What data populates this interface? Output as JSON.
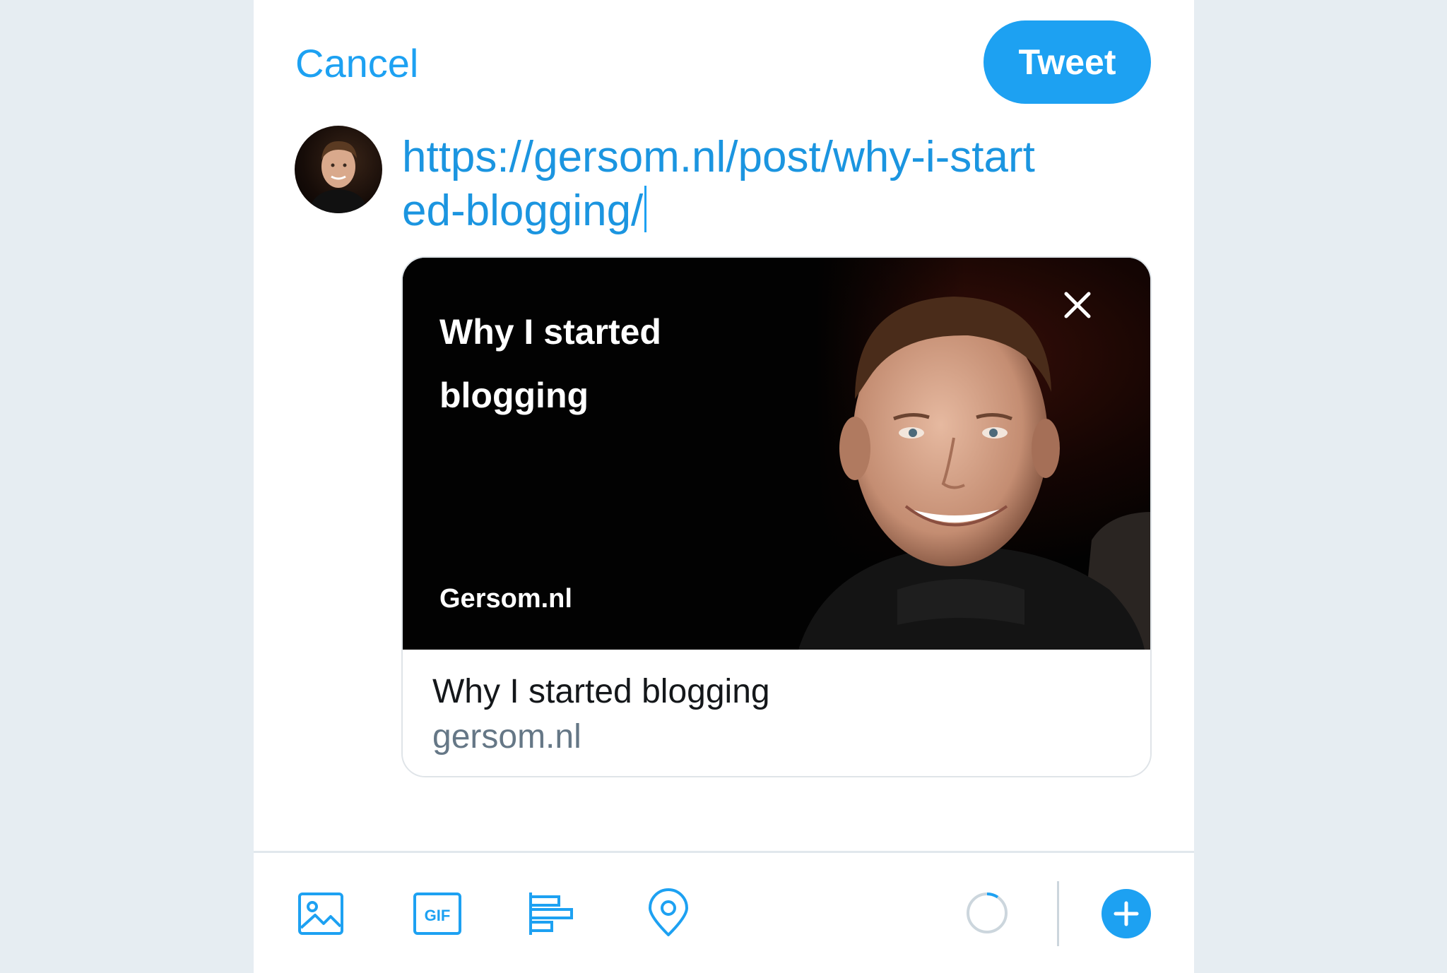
{
  "header": {
    "cancel_label": "Cancel",
    "tweet_label": "Tweet"
  },
  "compose": {
    "text": "https://gersom.nl/post/why-i-started-blogging/"
  },
  "link_card": {
    "image_title": "Why I started blogging",
    "image_brand": "Gersom.nl",
    "title": "Why I started blogging",
    "domain": "gersom.nl"
  },
  "toolbar": {
    "icons": [
      "image-icon",
      "gif-icon",
      "poll-icon",
      "location-icon",
      "character-count-ring",
      "add-thread-icon"
    ],
    "gif_label": "GIF"
  },
  "colors": {
    "accent": "#1da1f2",
    "link": "#1b95e0",
    "text": "#14171a",
    "secondary": "#657786",
    "background": "#e6edf2"
  }
}
